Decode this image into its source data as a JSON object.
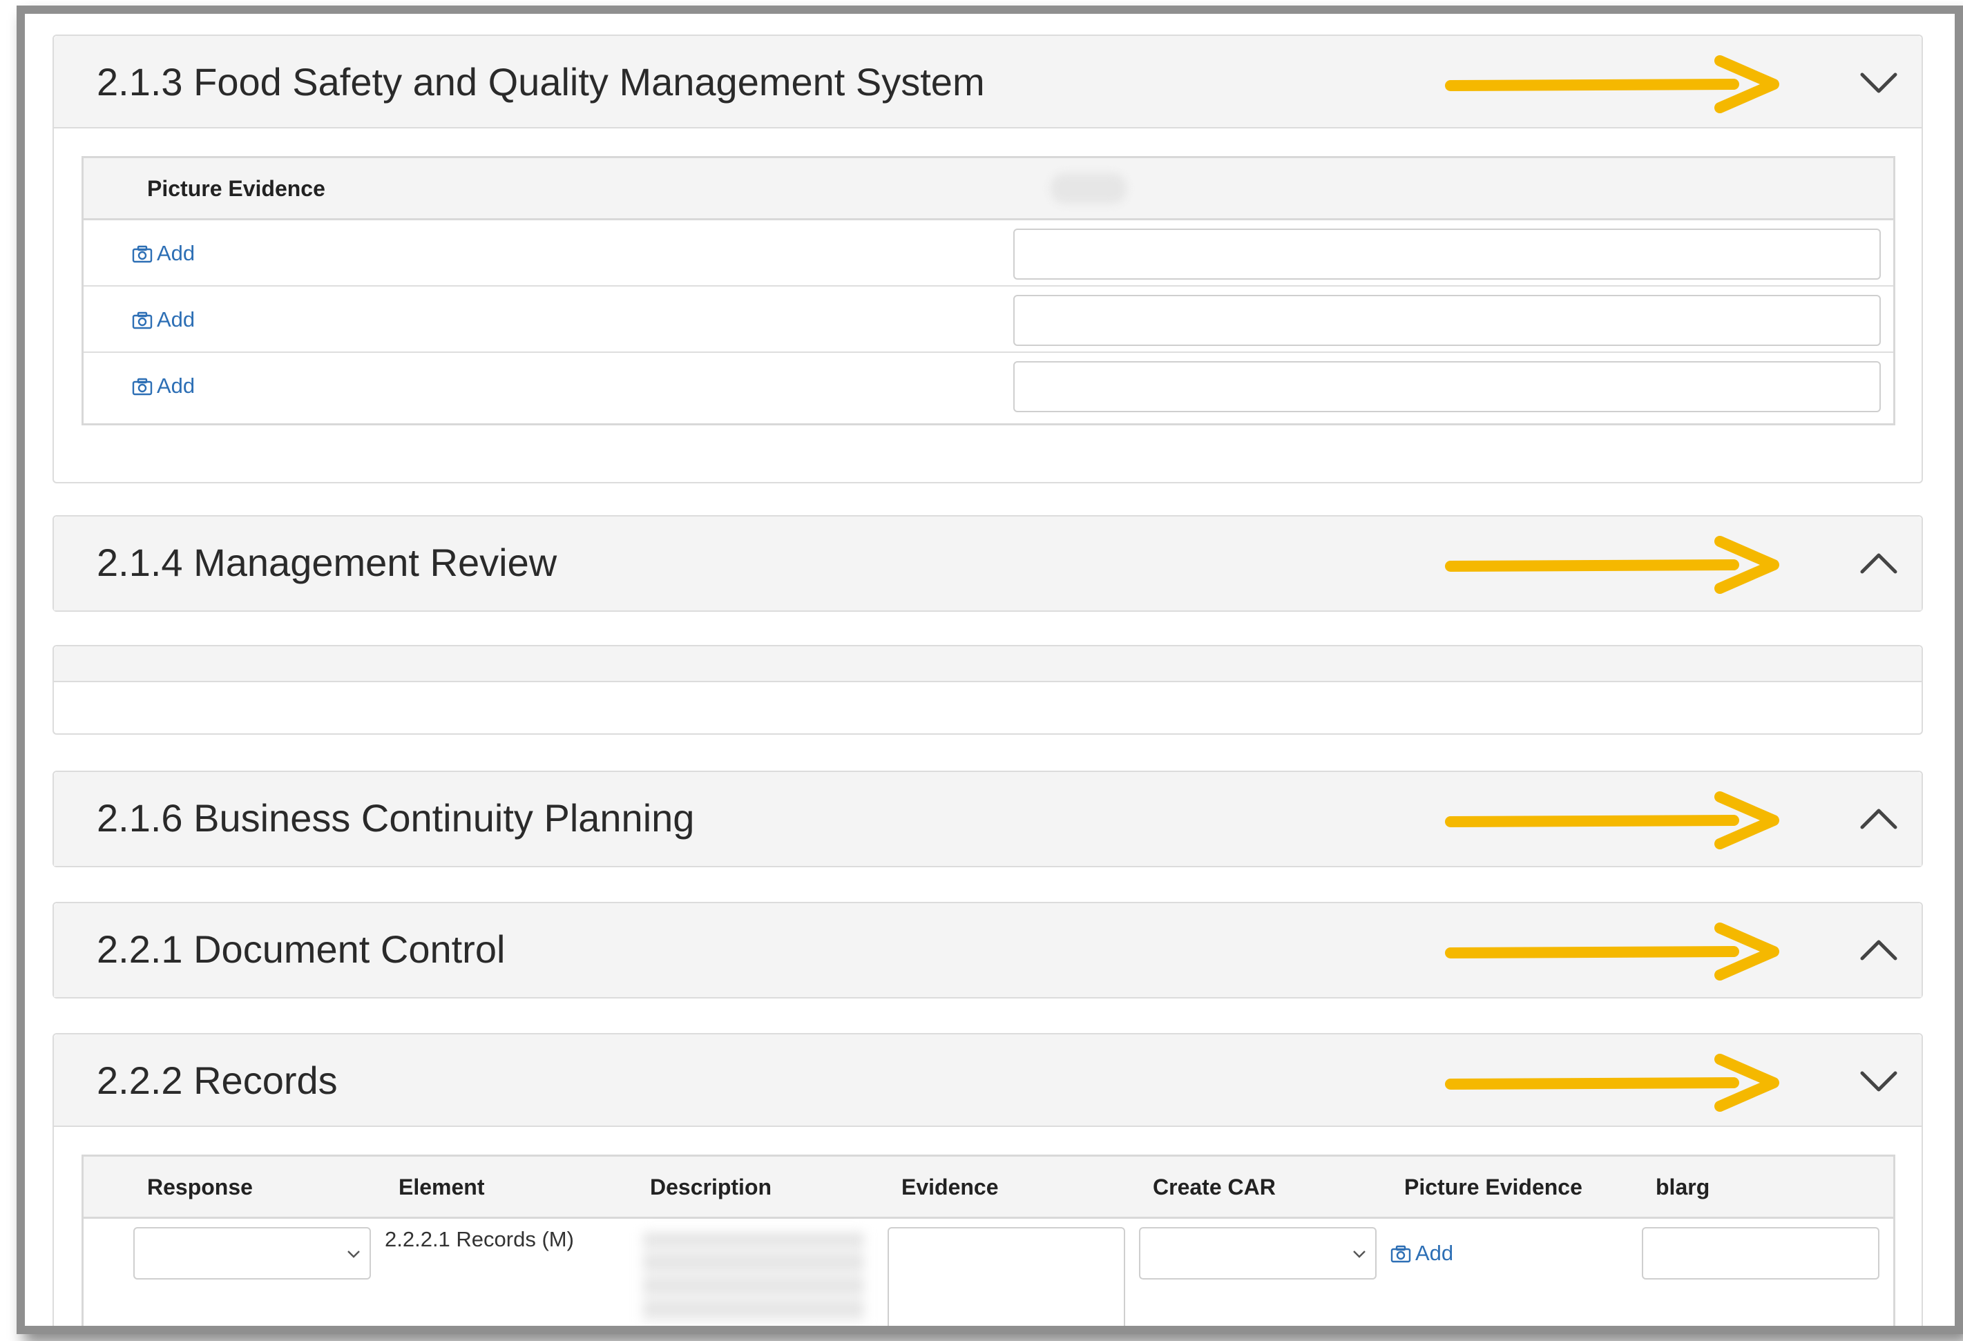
{
  "sections": [
    {
      "title": "2.1.3 Food Safety and Quality Management System",
      "chevron": "chevron-down-icon"
    },
    {
      "title": "2.1.4 Management Review",
      "chevron": "chevron-up-icon"
    },
    {
      "title": "2.1.6 Business Continuity Planning",
      "chevron": "chevron-up-icon"
    },
    {
      "title": "2.2.1 Document Control",
      "chevron": "chevron-up-icon"
    },
    {
      "title": "2.2.2 Records",
      "chevron": "chevron-down-icon"
    }
  ],
  "table_213": {
    "headers": [
      "Picture Evidence"
    ],
    "rows": [
      {
        "add_label": "Add",
        "input_value": ""
      },
      {
        "add_label": "Add",
        "input_value": ""
      },
      {
        "add_label": "Add",
        "input_value": ""
      }
    ]
  },
  "table_222": {
    "headers": [
      "Response",
      "Element",
      "Description",
      "Evidence",
      "Create CAR",
      "Picture Evidence",
      "blarg"
    ],
    "row": {
      "response_value": "",
      "element": "2.2.2.1 Records (M)",
      "evidence_value": "",
      "create_car_value": "",
      "add_label": "Add",
      "blarg_value": ""
    }
  },
  "annotation": {
    "arrow_color": "#f5b800"
  },
  "colors": {
    "link": "#2d6fb5",
    "header_bg": "#f4f4f4",
    "border": "#dcdcdc"
  }
}
